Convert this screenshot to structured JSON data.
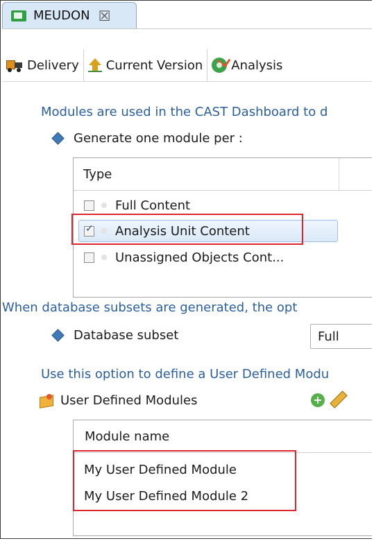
{
  "editor_tab": {
    "title": "MEUDON",
    "icon": "project-icon",
    "close_icon": "close-icon"
  },
  "toolbar": [
    {
      "label": "Delivery",
      "icon": "truck-icon"
    },
    {
      "label": "Current Version",
      "icon": "upload-arrow-icon"
    },
    {
      "label": "Analysis",
      "icon": "gear-check-icon"
    }
  ],
  "modules_info": "Modules are used in the CAST Dashboard to d",
  "generate_label": "Generate one module per :",
  "type_table": {
    "header": "Type",
    "rows": [
      {
        "label": "Full Content",
        "checked": false
      },
      {
        "label": "Analysis Unit Content",
        "checked": true
      },
      {
        "label": "Unassigned Objects Cont...",
        "checked": false
      }
    ]
  },
  "subset_info": "When database subsets are generated, the opt",
  "subset_label": "Database subset",
  "subset_value": "Full",
  "udm_info": "Use this option to define a User Defined Modu",
  "udm_label": "User Defined Modules",
  "module_table": {
    "header": "Module name",
    "rows": [
      "My User Defined Module",
      "My User Defined Module 2"
    ]
  },
  "colors": {
    "accent_text": "#2a5f9e",
    "highlight_border": "#e0242b",
    "selection_bg": "#dbe9f8"
  }
}
